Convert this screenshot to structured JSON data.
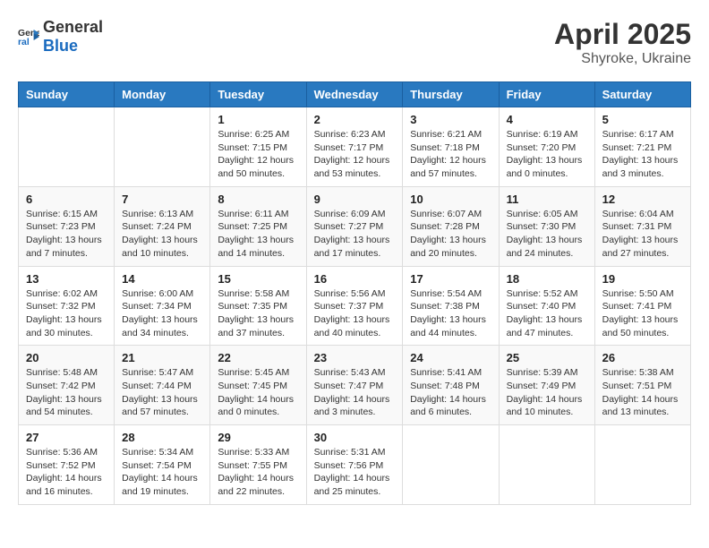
{
  "logo": {
    "general": "General",
    "blue": "Blue"
  },
  "title": "April 2025",
  "location": "Shyroke, Ukraine",
  "days_of_week": [
    "Sunday",
    "Monday",
    "Tuesday",
    "Wednesday",
    "Thursday",
    "Friday",
    "Saturday"
  ],
  "weeks": [
    [
      {
        "day": "",
        "info": ""
      },
      {
        "day": "",
        "info": ""
      },
      {
        "day": "1",
        "info": "Sunrise: 6:25 AM\nSunset: 7:15 PM\nDaylight: 12 hours and 50 minutes."
      },
      {
        "day": "2",
        "info": "Sunrise: 6:23 AM\nSunset: 7:17 PM\nDaylight: 12 hours and 53 minutes."
      },
      {
        "day": "3",
        "info": "Sunrise: 6:21 AM\nSunset: 7:18 PM\nDaylight: 12 hours and 57 minutes."
      },
      {
        "day": "4",
        "info": "Sunrise: 6:19 AM\nSunset: 7:20 PM\nDaylight: 13 hours and 0 minutes."
      },
      {
        "day": "5",
        "info": "Sunrise: 6:17 AM\nSunset: 7:21 PM\nDaylight: 13 hours and 3 minutes."
      }
    ],
    [
      {
        "day": "6",
        "info": "Sunrise: 6:15 AM\nSunset: 7:23 PM\nDaylight: 13 hours and 7 minutes."
      },
      {
        "day": "7",
        "info": "Sunrise: 6:13 AM\nSunset: 7:24 PM\nDaylight: 13 hours and 10 minutes."
      },
      {
        "day": "8",
        "info": "Sunrise: 6:11 AM\nSunset: 7:25 PM\nDaylight: 13 hours and 14 minutes."
      },
      {
        "day": "9",
        "info": "Sunrise: 6:09 AM\nSunset: 7:27 PM\nDaylight: 13 hours and 17 minutes."
      },
      {
        "day": "10",
        "info": "Sunrise: 6:07 AM\nSunset: 7:28 PM\nDaylight: 13 hours and 20 minutes."
      },
      {
        "day": "11",
        "info": "Sunrise: 6:05 AM\nSunset: 7:30 PM\nDaylight: 13 hours and 24 minutes."
      },
      {
        "day": "12",
        "info": "Sunrise: 6:04 AM\nSunset: 7:31 PM\nDaylight: 13 hours and 27 minutes."
      }
    ],
    [
      {
        "day": "13",
        "info": "Sunrise: 6:02 AM\nSunset: 7:32 PM\nDaylight: 13 hours and 30 minutes."
      },
      {
        "day": "14",
        "info": "Sunrise: 6:00 AM\nSunset: 7:34 PM\nDaylight: 13 hours and 34 minutes."
      },
      {
        "day": "15",
        "info": "Sunrise: 5:58 AM\nSunset: 7:35 PM\nDaylight: 13 hours and 37 minutes."
      },
      {
        "day": "16",
        "info": "Sunrise: 5:56 AM\nSunset: 7:37 PM\nDaylight: 13 hours and 40 minutes."
      },
      {
        "day": "17",
        "info": "Sunrise: 5:54 AM\nSunset: 7:38 PM\nDaylight: 13 hours and 44 minutes."
      },
      {
        "day": "18",
        "info": "Sunrise: 5:52 AM\nSunset: 7:40 PM\nDaylight: 13 hours and 47 minutes."
      },
      {
        "day": "19",
        "info": "Sunrise: 5:50 AM\nSunset: 7:41 PM\nDaylight: 13 hours and 50 minutes."
      }
    ],
    [
      {
        "day": "20",
        "info": "Sunrise: 5:48 AM\nSunset: 7:42 PM\nDaylight: 13 hours and 54 minutes."
      },
      {
        "day": "21",
        "info": "Sunrise: 5:47 AM\nSunset: 7:44 PM\nDaylight: 13 hours and 57 minutes."
      },
      {
        "day": "22",
        "info": "Sunrise: 5:45 AM\nSunset: 7:45 PM\nDaylight: 14 hours and 0 minutes."
      },
      {
        "day": "23",
        "info": "Sunrise: 5:43 AM\nSunset: 7:47 PM\nDaylight: 14 hours and 3 minutes."
      },
      {
        "day": "24",
        "info": "Sunrise: 5:41 AM\nSunset: 7:48 PM\nDaylight: 14 hours and 6 minutes."
      },
      {
        "day": "25",
        "info": "Sunrise: 5:39 AM\nSunset: 7:49 PM\nDaylight: 14 hours and 10 minutes."
      },
      {
        "day": "26",
        "info": "Sunrise: 5:38 AM\nSunset: 7:51 PM\nDaylight: 14 hours and 13 minutes."
      }
    ],
    [
      {
        "day": "27",
        "info": "Sunrise: 5:36 AM\nSunset: 7:52 PM\nDaylight: 14 hours and 16 minutes."
      },
      {
        "day": "28",
        "info": "Sunrise: 5:34 AM\nSunset: 7:54 PM\nDaylight: 14 hours and 19 minutes."
      },
      {
        "day": "29",
        "info": "Sunrise: 5:33 AM\nSunset: 7:55 PM\nDaylight: 14 hours and 22 minutes."
      },
      {
        "day": "30",
        "info": "Sunrise: 5:31 AM\nSunset: 7:56 PM\nDaylight: 14 hours and 25 minutes."
      },
      {
        "day": "",
        "info": ""
      },
      {
        "day": "",
        "info": ""
      },
      {
        "day": "",
        "info": ""
      }
    ]
  ]
}
